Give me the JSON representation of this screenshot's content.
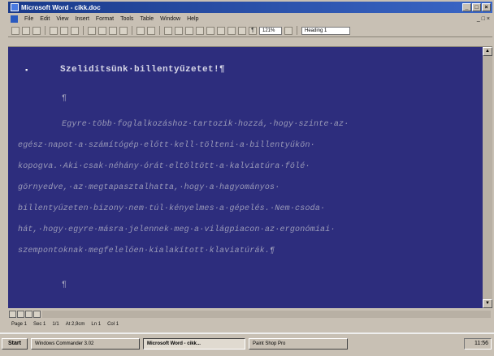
{
  "window": {
    "title": "Microsoft Word - cikk.doc"
  },
  "menu": [
    "File",
    "Edit",
    "View",
    "Insert",
    "Format",
    "Tools",
    "Table",
    "Window",
    "Help"
  ],
  "toolbar": {
    "zoom": "121%",
    "style": "Heading 1"
  },
  "document": {
    "heading": "Szelidítsünk·billentyűzetet!¶",
    "empty_mark": "¶",
    "paragraph_lines": [
      "Egyre·több·foglalkozáshoz·tartozik·hozzá,·hogy·szinte·az·",
      "egész·napot·a·számítógép·előtt·kell·tölteni·a·billentyűkön·",
      "kopogva.·Aki·csak·néhány·órát·eltöltött·a·kalviatúra·fölé·",
      "görnyedve,·az·megtapasztalhatta,·hogy·a·hagyományos·",
      "billentyűzeten·bizony·nem·túl·kényelmes·a·gépelés.·Nem·csoda·",
      "hát,·hogy·egyre·másra·jelennek·meg·a·világpiacon·az·ergonómiai·",
      "szempontoknak·megfelelően·kialakított·klaviatúrák.¶"
    ],
    "trailing_mark": "¶"
  },
  "status": {
    "page": "Page 1",
    "section": "Sec 1",
    "count": "1/1",
    "at": "At 2,9cm",
    "ln": "Ln 1",
    "col": "Col 1"
  },
  "taskbar": {
    "start": "Start",
    "tasks": [
      "Windows Commander 3.02",
      "Microsoft Word - cikk...",
      "Paint Shop Pro"
    ],
    "clock": "11:56"
  },
  "colors": {
    "document_bg": "#2d2d7d",
    "title_gradient_start": "#1a3a8a",
    "chrome": "#c8c0b4"
  }
}
